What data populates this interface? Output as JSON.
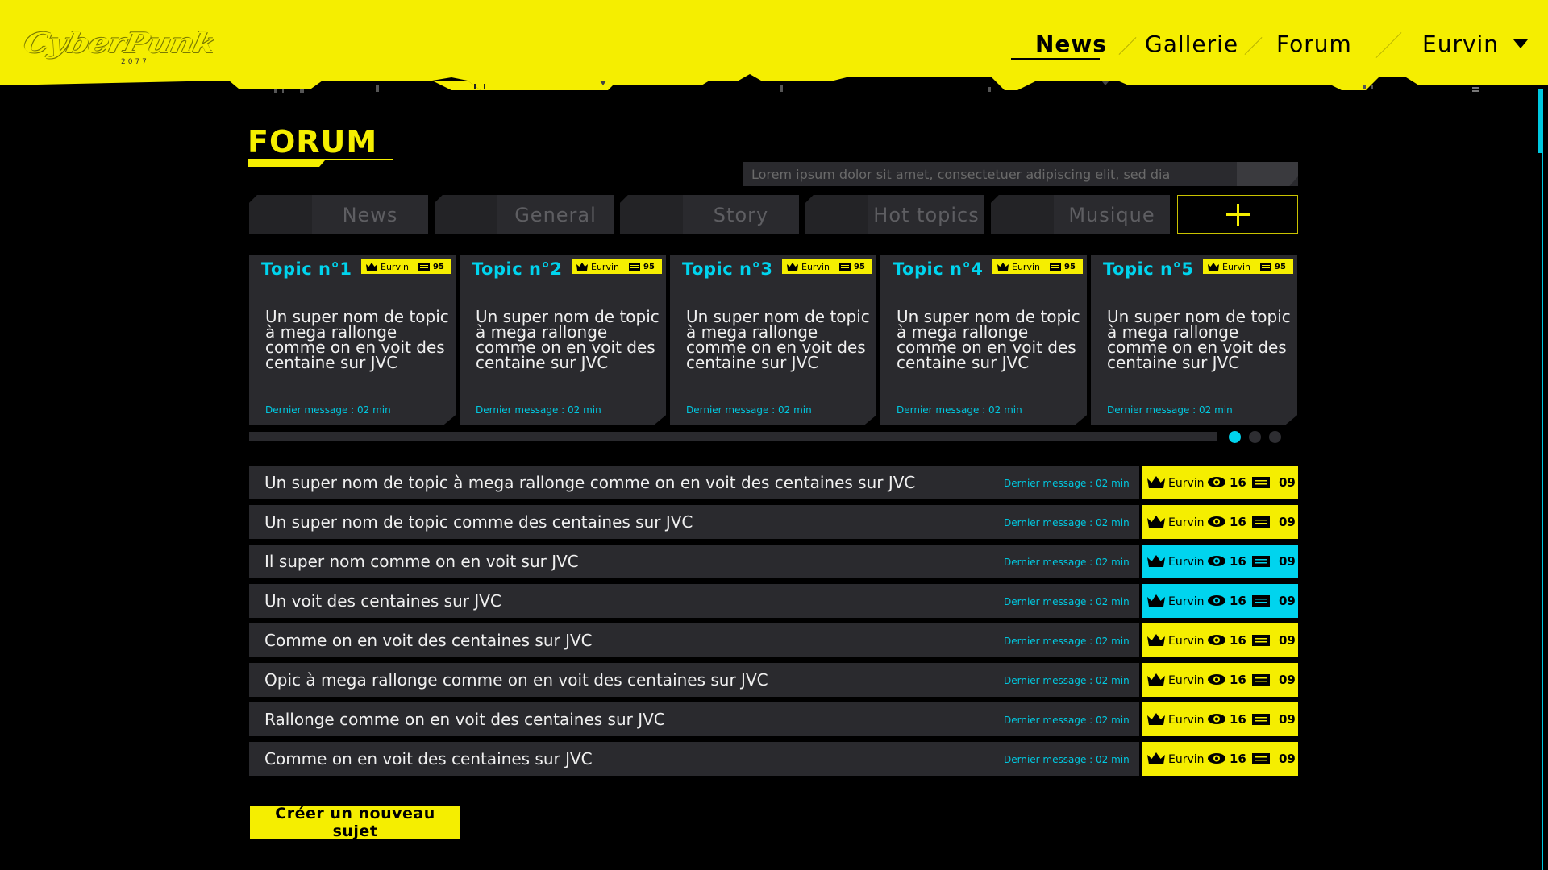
{
  "header": {
    "logo_text": "CyberPunk",
    "logo_sub": "2077",
    "nav": [
      {
        "label": "News",
        "active": true
      },
      {
        "label": "Gallerie",
        "active": false
      },
      {
        "label": "Forum",
        "active": false
      }
    ],
    "user": "Eurvin",
    "accent": "#f5ee00"
  },
  "forum": {
    "title": "FORUM",
    "search_placeholder": "Lorem ipsum dolor sit amet, consectetuer adipiscing elit, sed dia",
    "tabs": [
      "News",
      "General",
      "Story",
      "Hot topics",
      "Musique"
    ],
    "add_tab_icon": "plus-icon"
  },
  "cards": [
    {
      "title": "Topic n°1",
      "author": "Eurvin",
      "count": "95",
      "body": "Un super nom de topic à mega rallonge comme on en voit des centaine sur JVC",
      "last": "Dernier message : 02 min"
    },
    {
      "title": "Topic n°2",
      "author": "Eurvin",
      "count": "95",
      "body": "Un super nom de topic à mega rallonge comme on en voit des centaine sur JVC",
      "last": "Dernier message : 02 min"
    },
    {
      "title": "Topic n°3",
      "author": "Eurvin",
      "count": "95",
      "body": "Un super nom de topic à mega rallonge comme on en voit des centaine sur JVC",
      "last": "Dernier message : 02 min"
    },
    {
      "title": "Topic n°4",
      "author": "Eurvin",
      "count": "95",
      "body": "Un super nom de topic à mega rallonge comme on en voit des centaine sur JVC",
      "last": "Dernier message : 02 min"
    },
    {
      "title": "Topic n°5",
      "author": "Eurvin",
      "count": "95",
      "body": "Un super nom de topic à mega rallonge comme on en voit des centaine sur JVC",
      "last": "Dernier message : 02 min"
    }
  ],
  "carousel": {
    "pages": 3,
    "active": 0
  },
  "topics": [
    {
      "title": "Un super nom de topic à mega rallonge comme on en voit des centaines sur JVC",
      "last": "Dernier message : 02 min",
      "author": "Eurvin",
      "views": "16",
      "replies": "09",
      "highlight": "yellow"
    },
    {
      "title": "Un super nom de topic comme des centaines sur JVC",
      "last": "Dernier message : 02 min",
      "author": "Eurvin",
      "views": "16",
      "replies": "09",
      "highlight": "yellow"
    },
    {
      "title": "Il super nom  comme on en voit sur JVC",
      "last": "Dernier message : 02 min",
      "author": "Eurvin",
      "views": "16",
      "replies": "09",
      "highlight": "cyan"
    },
    {
      "title": "Un voit des centaines sur JVC",
      "last": "Dernier message : 02 min",
      "author": "Eurvin",
      "views": "16",
      "replies": "09",
      "highlight": "cyan"
    },
    {
      "title": "Comme on en voit des centaines sur JVC",
      "last": "Dernier message : 02 min",
      "author": "Eurvin",
      "views": "16",
      "replies": "09",
      "highlight": "yellow"
    },
    {
      "title": "Opic à mega rallonge comme on en voit des centaines sur JVC",
      "last": "Dernier message : 02 min",
      "author": "Eurvin",
      "views": "16",
      "replies": "09",
      "highlight": "yellow"
    },
    {
      "title": "Rallonge comme on en voit des centaines sur JVC",
      "last": "Dernier message : 02 min",
      "author": "Eurvin",
      "views": "16",
      "replies": "09",
      "highlight": "yellow"
    },
    {
      "title": "Comme on en voit des centaines sur JVC",
      "last": "Dernier message : 02 min",
      "author": "Eurvin",
      "views": "16",
      "replies": "09",
      "highlight": "yellow"
    }
  ],
  "create_button": "Créer un nouveau sujet",
  "colors": {
    "yellow": "#f5ee00",
    "cyan": "#00d4ee",
    "panel": "#2a2a2e"
  }
}
